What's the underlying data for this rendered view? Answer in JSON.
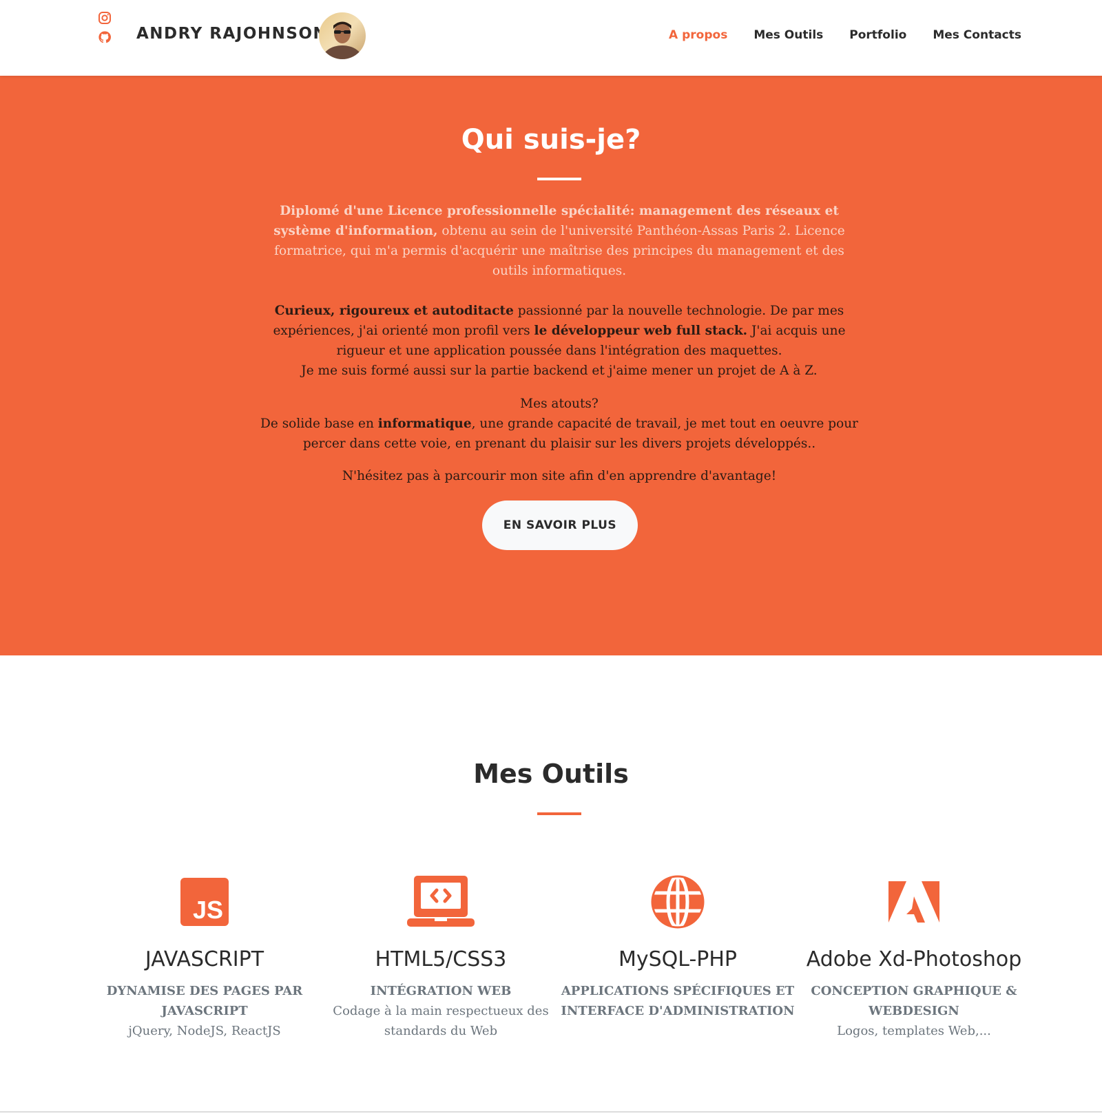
{
  "header": {
    "brand": "ANDRY RAJOHNSON",
    "social": [
      {
        "icon": "instagram-icon"
      },
      {
        "icon": "github-icon"
      }
    ],
    "nav": [
      {
        "label": "A propos",
        "active": true
      },
      {
        "label": "Mes Outils",
        "active": false
      },
      {
        "label": "Portfolio",
        "active": false
      },
      {
        "label": "Mes Contacts",
        "active": false
      }
    ]
  },
  "hero": {
    "title": "Qui suis-je?",
    "para1": {
      "bold": "Diplomé d'une Licence professionnelle spécialité: management des réseaux et système d'information,",
      "rest": " obtenu au sein de l'université Panthéon-Assas Paris 2. Licence formatrice, qui m'a permis d'acquérir une maîtrise des principes du management et des outils informatiques."
    },
    "para2": {
      "bold1": "Curieux, rigoureux et autoditacte",
      "text1": " passionné par la nouvelle technologie. De par mes expériences, j'ai orienté mon profil vers ",
      "bold2": "le développeur web full stack.",
      "text2": " J'ai acquis une rigueur et une application poussée dans l'intégration des maquettes.",
      "line2": "Je me suis formé aussi sur la partie backend et j'aime mener un projet de A à Z."
    },
    "para3": {
      "line1": "Mes atouts?",
      "text1": "De solide base en ",
      "bold": "informatique",
      "text2": ", une grande capacité de travail, je met tout en oeuvre pour percer dans cette voie, en prenant du plaisir sur les divers projets développés.."
    },
    "para4": "N'hésitez pas à parcourir mon site afin d'en apprendre d'avantage!",
    "button": "EN SAVOIR PLUS"
  },
  "tools": {
    "title": "Mes Outils",
    "items": [
      {
        "icon": "javascript-icon",
        "name": "JAVASCRIPT",
        "subtitle": "Dynamise des pages par JavaScript",
        "desc": "jQuery, NodeJS, ReactJS"
      },
      {
        "icon": "laptop-code-icon",
        "name": "HTML5/CSS3",
        "subtitle": "Intégration Web",
        "desc": "Codage à la main respectueux des standards du Web"
      },
      {
        "icon": "globe-icon",
        "name": "MySQL-PHP",
        "subtitle": "Applications spécifiques et interface d'administration",
        "desc": ""
      },
      {
        "icon": "adobe-icon",
        "name": "Adobe Xd-Photoshop",
        "subtitle": "Conception graphique & Webdesign",
        "desc": "Logos, templates Web,..."
      }
    ]
  },
  "colors": {
    "accent": "#f2653b",
    "text_dark": "#2b2b2b",
    "muted": "#6c757d"
  }
}
